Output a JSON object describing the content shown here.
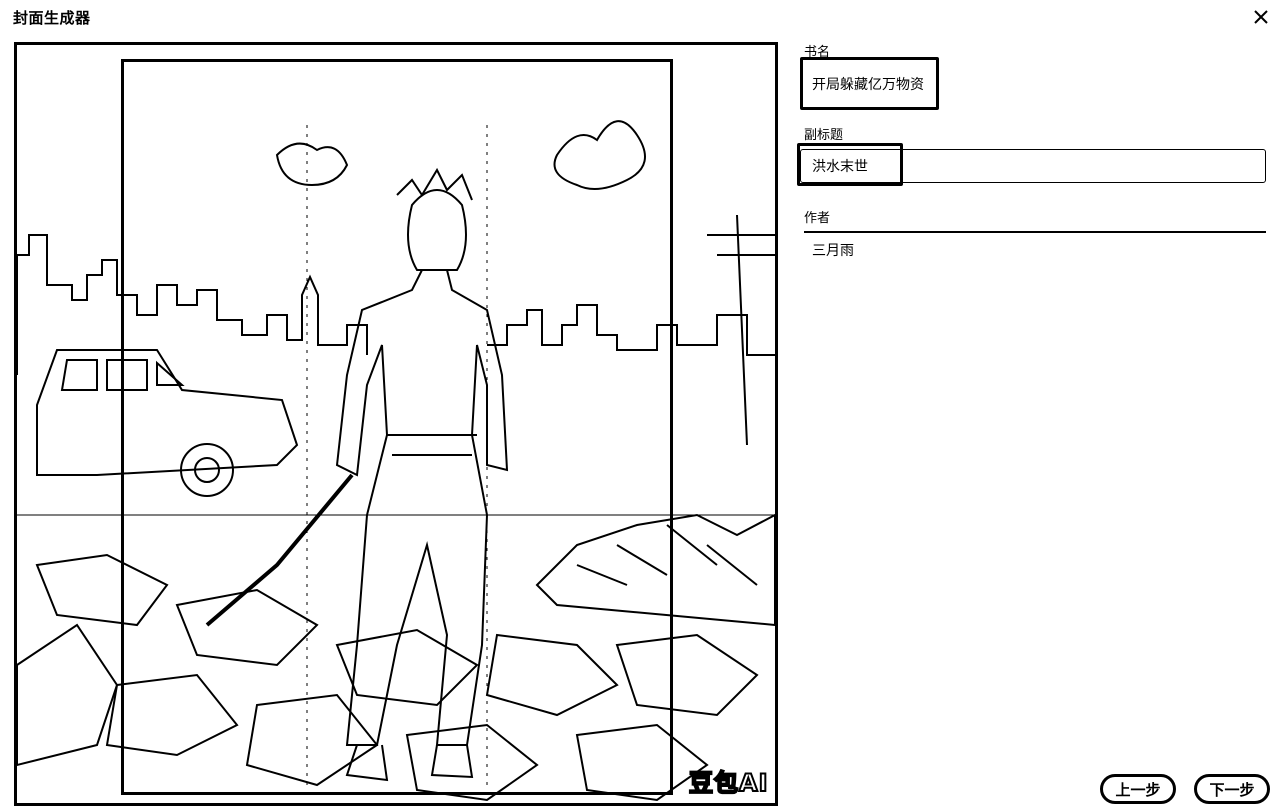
{
  "window": {
    "title": "封面生成器"
  },
  "canvas": {
    "watermark": "豆包AI"
  },
  "form": {
    "book_title_label": "书名",
    "book_title_value": "开局躲藏亿万物资",
    "subtitle_label": "副标题",
    "subtitle_value": "洪水末世",
    "author_label": "作者",
    "author_value": "三月雨"
  },
  "buttons": {
    "prev_label": "上一步",
    "next_label": "下一步"
  }
}
